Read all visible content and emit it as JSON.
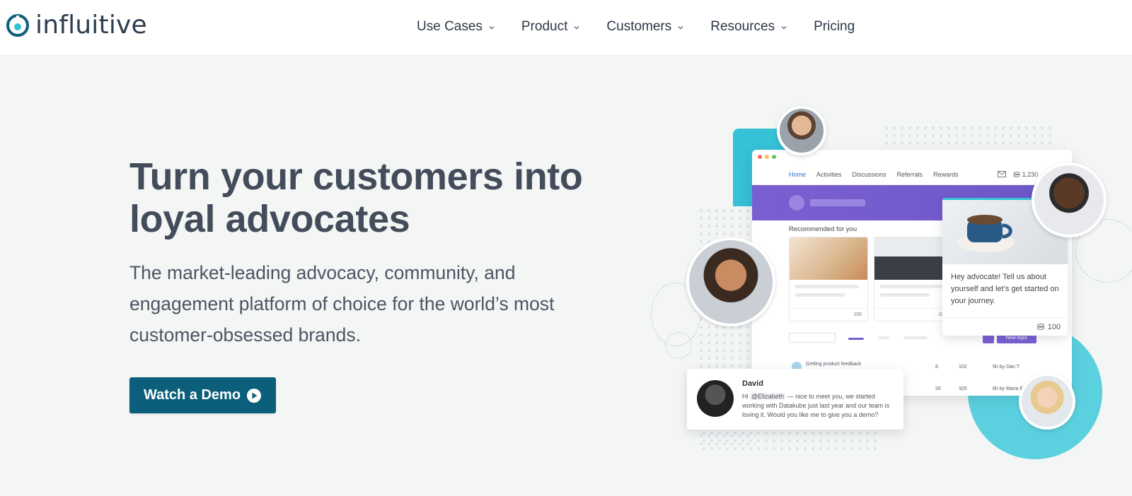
{
  "brand": {
    "name": "influitive",
    "color": "#0c5f7a"
  },
  "nav": {
    "items": [
      {
        "label": "Use Cases",
        "has_dropdown": true
      },
      {
        "label": "Product",
        "has_dropdown": true
      },
      {
        "label": "Customers",
        "has_dropdown": true
      },
      {
        "label": "Resources",
        "has_dropdown": true
      },
      {
        "label": "Pricing",
        "has_dropdown": false
      }
    ]
  },
  "hero": {
    "title": "Turn your customers into loyal advocates",
    "subtitle": "The market-leading advocacy, community, and engagement platform of choice for the world’s most customer-obsessed brands.",
    "cta_label": "Watch a Demo",
    "cta_icon": "play-circle-icon"
  },
  "illustration": {
    "app_tabs": [
      "Home",
      "Activities",
      "Discussions",
      "Referrals",
      "Rewards"
    ],
    "points": "1,230",
    "recommended_label": "Recommended for you",
    "card_points": "100",
    "new_topic_label": "New topic",
    "topic_title": "Getting product feedback",
    "topic_stats": [
      "6",
      "102",
      "5h by Dan T."
    ],
    "topic_stats_2": [
      "26",
      "325",
      "6h by Maria E."
    ],
    "side_card_text": "Hey advocate! Tell us about yourself and let’s get started on your journey.",
    "side_card_points": "100",
    "message": {
      "author": "David",
      "greeting": "Hi",
      "mention": "@Elizabeth",
      "text": "— nice to meet you, we started working with Datakube just last year and our team is loving it. Would you like me to give you a demo?"
    }
  }
}
